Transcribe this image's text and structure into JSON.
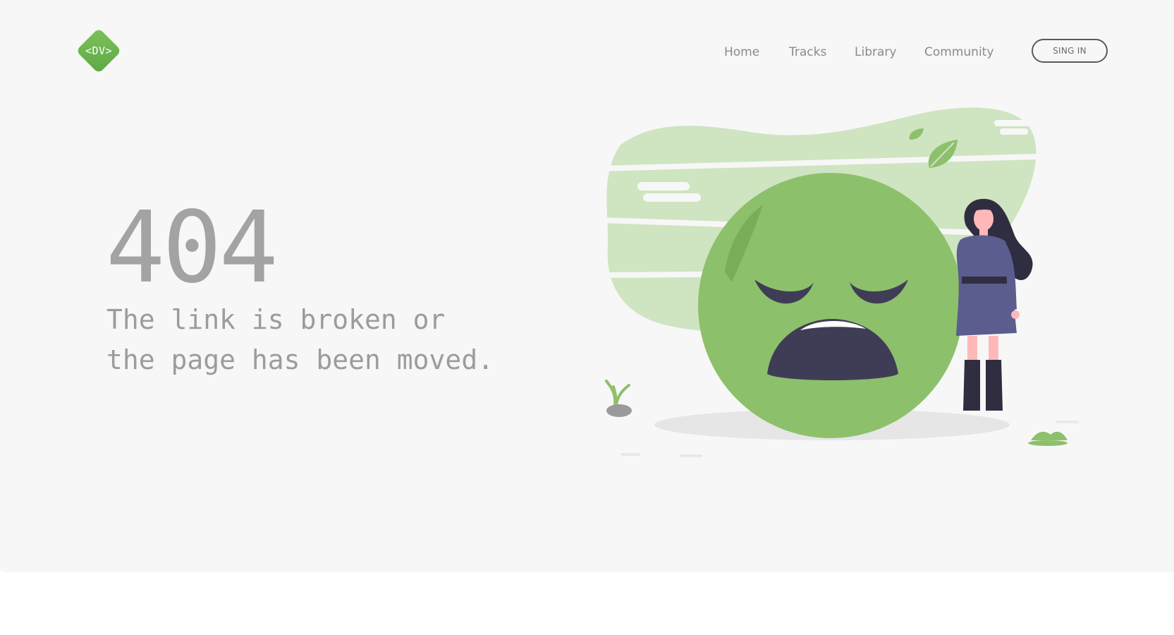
{
  "header": {
    "logo_text": "<DV>",
    "nav": [
      {
        "label": "Home"
      },
      {
        "label": "Tracks"
      },
      {
        "label": "Library"
      },
      {
        "label": "Community"
      }
    ],
    "signin_label": "SING IN"
  },
  "error": {
    "code": "404",
    "message_line1": "The link is broken or",
    "message_line2": "the page has been moved."
  },
  "colors": {
    "brand_green": "#6fb553",
    "emoji_green": "#8dc06b",
    "blob_green": "#cfe4c0",
    "text_gray": "#9c9c9c",
    "dress_purple": "#5b5d8f",
    "mouth_dark": "#3f3d56"
  },
  "icons": {
    "logo": "diamond-logo-icon",
    "illustration": "sad-face-illustration"
  }
}
